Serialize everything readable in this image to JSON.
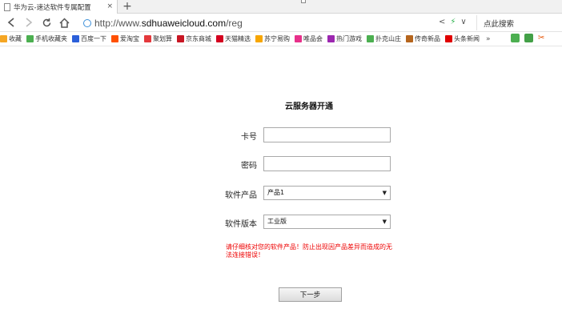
{
  "browser": {
    "tab_title": "华为云-速达软件专属配置",
    "tab_close": "×",
    "new_tab": "+",
    "url_protocol": "http://www.",
    "url_host": "sdhuaweicloud.com",
    "url_path": "/reg",
    "search_placeholder": "点此搜索"
  },
  "bookmarks": {
    "items": [
      {
        "label": "收藏",
        "icon": "star-icon",
        "color": "#f5a623"
      },
      {
        "label": "手机收藏夹",
        "icon": "phone-icon",
        "color": "#4caf50"
      },
      {
        "label": "百度一下",
        "icon": "baidu-icon",
        "color": "#2b5fd9"
      },
      {
        "label": "爱淘宝",
        "icon": "taobao-icon",
        "color": "#ff5000"
      },
      {
        "label": "聚划算",
        "icon": "juhuasuan-icon",
        "color": "#e4393c"
      },
      {
        "label": "京东商城",
        "icon": "jd-icon",
        "color": "#c81623"
      },
      {
        "label": "天猫精选",
        "icon": "tmall-icon",
        "color": "#d4001f"
      },
      {
        "label": "苏宁易购",
        "icon": "suning-icon",
        "color": "#f7a600"
      },
      {
        "label": "唯品会",
        "icon": "vip-icon",
        "color": "#e7308a"
      },
      {
        "label": "热门游戏",
        "icon": "game-icon",
        "color": "#9c27b0"
      },
      {
        "label": "扑克山庄",
        "icon": "poker-icon",
        "color": "#4caf50"
      },
      {
        "label": "传奇新品",
        "icon": "legend-icon",
        "color": "#b5651d"
      },
      {
        "label": "头条新闻",
        "icon": "news-icon",
        "color": "#e00000"
      }
    ],
    "more": "»"
  },
  "form": {
    "title": "云服务器开通",
    "card_label": "卡号",
    "card_value": "",
    "password_label": "密码",
    "password_value": "",
    "product_label": "软件产品",
    "product_selected": "产品1",
    "version_label": "软件版本",
    "version_selected": "工业版",
    "warning": "请仔细核对您的软件产品！防止出现因产品差异而造成的无法连接错误！",
    "next_button": "下一步"
  }
}
